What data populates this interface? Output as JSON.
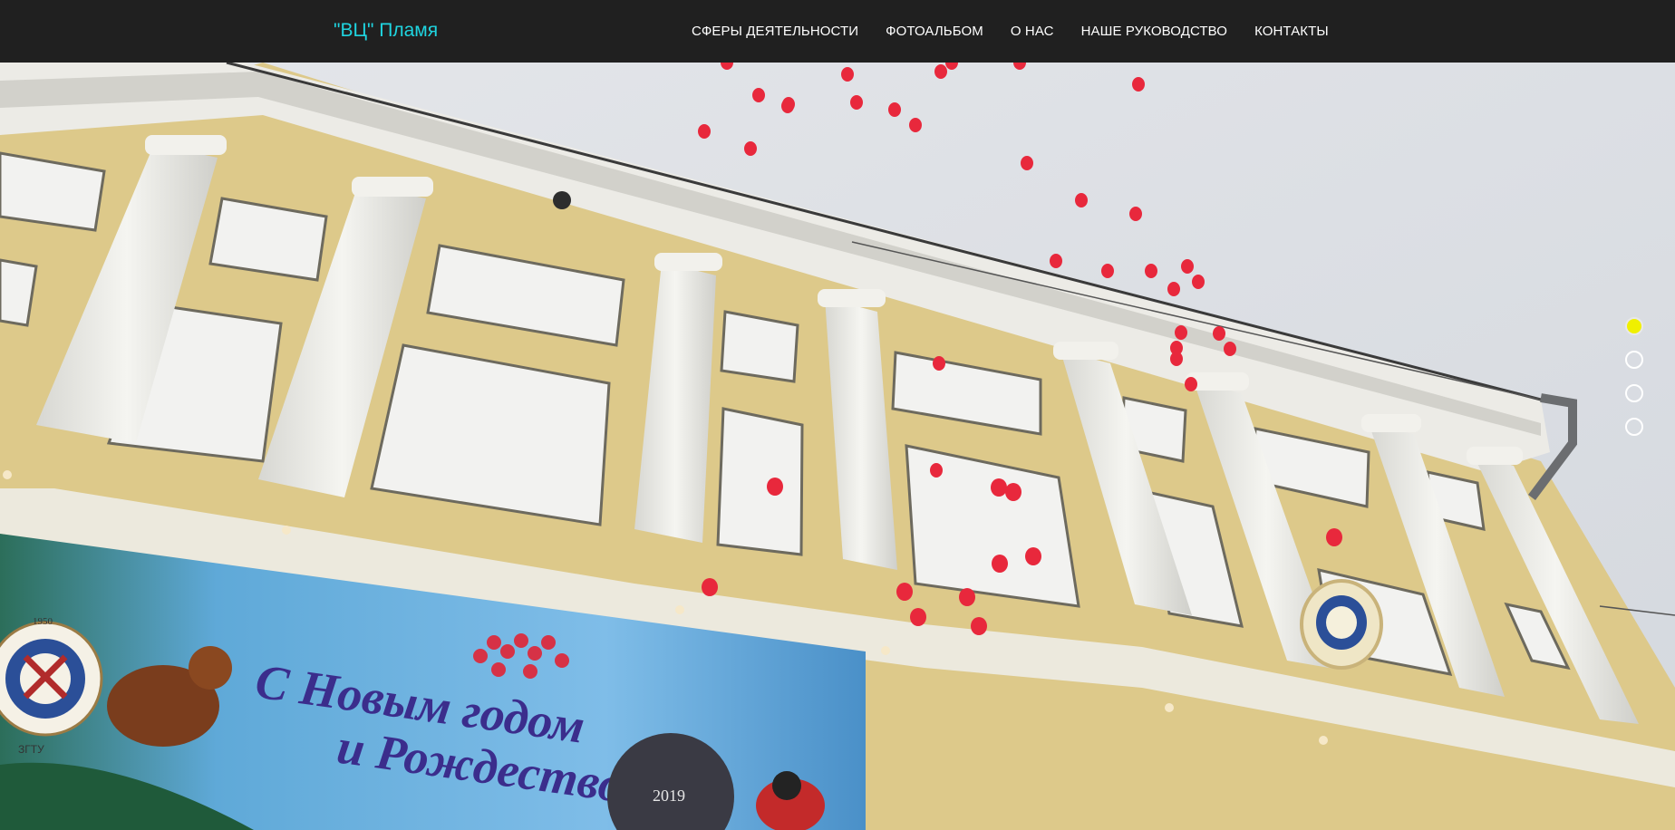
{
  "brand": {
    "name": "\"ВЦ\" Пламя"
  },
  "nav": {
    "items": [
      {
        "label": "СФЕРЫ ДЕЯТЕЛЬНОСТИ"
      },
      {
        "label": "ФОТОАЛЬБОМ"
      },
      {
        "label": "О НАС"
      },
      {
        "label": "НАШЕ РУКОВОДСТВО"
      },
      {
        "label": "КОНТАКТЫ"
      }
    ]
  },
  "hero": {
    "banner_text_line1": "С Новым годом",
    "banner_text_line2": "и Рождеством",
    "banner_year": "2019",
    "emblem_year": "1950",
    "emblem_abbr": "ЗГТУ"
  },
  "slider": {
    "count": 4,
    "active_index": 0
  },
  "colors": {
    "brand": "#1fd5e0",
    "navbar": "#202020",
    "dot_active": "#f0f000",
    "balloon": "#e8283c"
  }
}
